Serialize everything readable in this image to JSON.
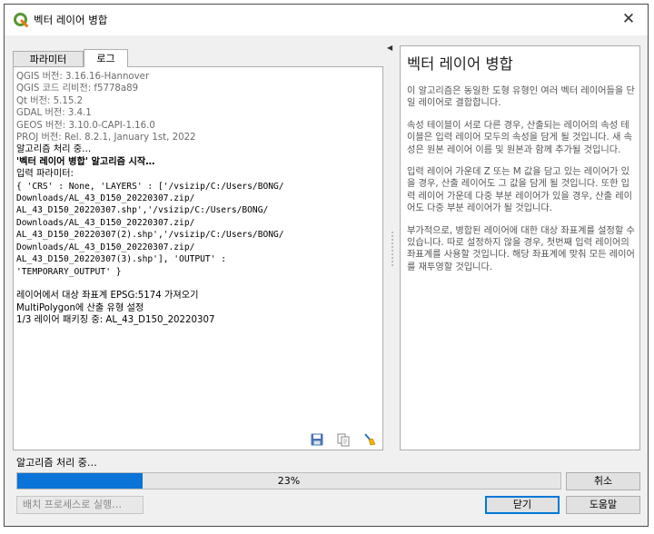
{
  "window": {
    "title": "벡터 레이어 병합",
    "close_symbol": "✕"
  },
  "tabs": [
    {
      "label": "파라미터",
      "active": false
    },
    {
      "label": "로그",
      "active": true
    }
  ],
  "log": {
    "info_lines": [
      "QGIS 버전: 3.16.16-Hannover",
      "QGIS 코드 리비전: f5778a89",
      "Qt 버전: 5.15.2",
      "GDAL 버전: 3.4.1",
      "GEOS 버전: 3.10.0-CAPI-1.16.0",
      "PROJ 버전: Rel. 8.2.1, January 1st, 2022"
    ],
    "processing": "알고리즘 처리 중…",
    "start": "'벡터 레이어 병합' 알고리즘 시작…",
    "input_params_label": "입력 파라미터:",
    "params_lines": [
      "{ 'CRS' : None, 'LAYERS' : ['/vsizip/C:/Users/BONG/",
      "Downloads/AL_43_D150_20220307.zip/",
      "AL_43_D150_20220307.shp','/vsizip/C:/Users/BONG/",
      "Downloads/AL_43_D150_20220307.zip/",
      "AL_43_D150_20220307(2).shp','/vsizip/C:/Users/BONG/",
      "Downloads/AL_43_D150_20220307.zip/",
      "AL_43_D150_20220307(3).shp'], 'OUTPUT' :",
      "'TEMPORARY_OUTPUT' }"
    ],
    "result_lines": [
      "레이어에서 대상 좌표계 EPSG:5174 가져오기",
      "MultiPolygon에 산출 유형 설정",
      "1/3 레이어 패키징 중: AL_43_D150_20220307"
    ],
    "tools": [
      "save-icon",
      "copy-icon",
      "clear-icon"
    ]
  },
  "help": {
    "title": "벡터 레이어 병합",
    "paragraphs": [
      "이 알고리즘은 동일한 도형 유형인 여러 벡터 레이어들을 단일 레이어로 결합합니다.",
      "속성 테이블이 서로 다른 경우, 산출되는 레이어의 속성 테이블은 입력 레이어 모두의 속성을 담게 될 것입니다. 새 속성은 원본 레이어 이름 및 원본과 함께 추가될 것입니다.",
      "입력 레이어 가운데 Z 또는 M 값을 담고 있는 레이어가 있을 경우, 산출 레이어도 그 값을 담게 될 것입니다. 또한 입력 레이어 가운데 다중 부분 레이어가 있을 경우, 산출 레이어도 다중 부분 레이어가 될 것입니다.",
      "부가적으로, 병합된 레이어에 대한 대상 좌표계를 설정할 수 있습니다. 따로 설정하지 않을 경우, 첫번째 입력 레이어의 좌표계를 사용할 것입니다. 해당 좌표계에 맞춰 모든 레이어를 재투영할 것입니다."
    ]
  },
  "status": {
    "label": "알고리즘 처리 중…",
    "progress": 23,
    "progress_text": "23%"
  },
  "buttons": {
    "cancel": "취소",
    "batch": "배치 프로세스로 실행…",
    "close": "닫기",
    "help": "도움말"
  },
  "colors": {
    "accent": "#0a74d8",
    "qgis_green": "#589632",
    "qgis_yellow": "#ee7913"
  }
}
